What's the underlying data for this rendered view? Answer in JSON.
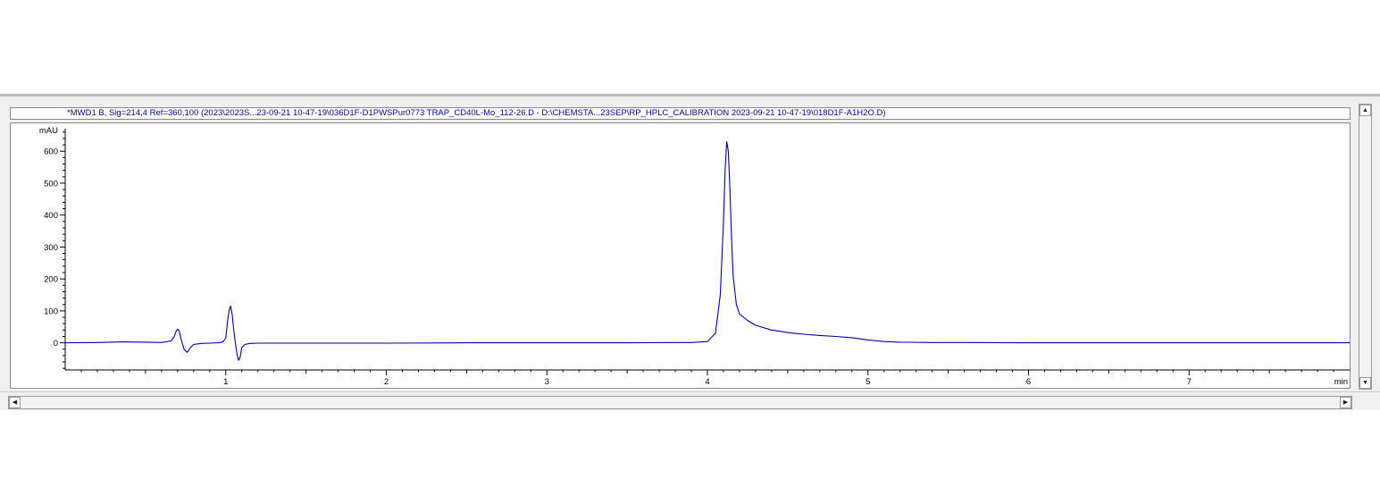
{
  "window": {
    "signal_label": "*MWD1 B, Sig=214,4 Ref=360,100 (2023\\2023S...23-09-21 10-47-19\\036D1F-D1PWSPur0773 TRAP_CD40L-Mo_112-26.D - D:\\CHEMSTA...23SEP\\RP_HPLC_CALIBRATION 2023-09-21 10-47-19\\018D1F-A1H2O.D)"
  },
  "chart_data": {
    "type": "line",
    "title": "",
    "ylabel": "mAU",
    "xlabel": "min",
    "xlim": [
      0.0,
      8.0
    ],
    "ylim": [
      -85,
      665
    ],
    "x_ticks": [
      1,
      2,
      3,
      4,
      5,
      6,
      7
    ],
    "x_tick_labels": [
      "1",
      "2",
      "3",
      "4",
      "5",
      "6",
      "7"
    ],
    "y_ticks": [
      0,
      100,
      200,
      300,
      400,
      500,
      600
    ],
    "y_tick_labels": [
      "0",
      "100",
      "200",
      "300",
      "400",
      "500",
      "600"
    ],
    "grid": false,
    "line_color": "#0000b0",
    "axis_color": "#000000",
    "text_color": "#000000",
    "series": [
      {
        "x": [
          0.0,
          0.2,
          0.35,
          0.5,
          0.6,
          0.66,
          0.68,
          0.69,
          0.7,
          0.71,
          0.72,
          0.74,
          0.76,
          0.78,
          0.8,
          0.85,
          0.9,
          0.95,
          0.98,
          1.0,
          1.01,
          1.02,
          1.03,
          1.04,
          1.05,
          1.06,
          1.07,
          1.08,
          1.09,
          1.1,
          1.12,
          1.15,
          1.2,
          1.5,
          2.0,
          2.5,
          3.0,
          3.5,
          3.9,
          4.0,
          4.05,
          4.08,
          4.1,
          4.11,
          4.12,
          4.13,
          4.14,
          4.15,
          4.16,
          4.18,
          4.2,
          4.25,
          4.3,
          4.4,
          4.5,
          4.6,
          4.7,
          4.8,
          4.9,
          5.0,
          5.1,
          5.2,
          5.4,
          5.6,
          6.0,
          7.0,
          8.0
        ],
        "y": [
          0,
          1,
          3,
          2,
          1,
          6,
          20,
          35,
          43,
          38,
          15,
          -20,
          -30,
          -15,
          -5,
          -2,
          -1,
          0,
          2,
          15,
          60,
          100,
          115,
          90,
          40,
          0,
          -35,
          -55,
          -45,
          -15,
          -5,
          -2,
          -1,
          -1,
          -1,
          0,
          0,
          0,
          1,
          4,
          30,
          150,
          380,
          540,
          630,
          600,
          480,
          330,
          210,
          120,
          90,
          70,
          55,
          40,
          32,
          27,
          23,
          20,
          16,
          9,
          4,
          2,
          1,
          1,
          0,
          0,
          0
        ]
      }
    ]
  }
}
